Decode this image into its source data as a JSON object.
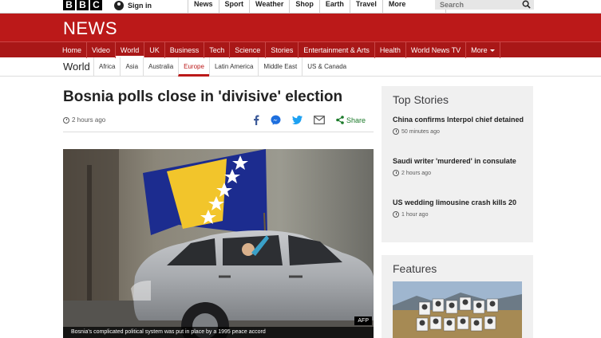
{
  "topbar": {
    "logo_letters": [
      "B",
      "B",
      "C"
    ],
    "signin": "Sign in",
    "links": [
      "News",
      "Sport",
      "Weather",
      "Shop",
      "Earth",
      "Travel",
      "More"
    ],
    "search_placeholder": "Search"
  },
  "masthead": {
    "title": "NEWS",
    "nav": [
      "Home",
      "Video",
      "World",
      "UK",
      "Business",
      "Tech",
      "Science",
      "Stories",
      "Entertainment & Arts",
      "Health",
      "World News TV",
      "More"
    ],
    "active": "World"
  },
  "subnav": {
    "title": "World",
    "links": [
      "Africa",
      "Asia",
      "Australia",
      "Europe",
      "Latin America",
      "Middle East",
      "US & Canada"
    ],
    "active": "Europe"
  },
  "article": {
    "headline": "Bosnia polls close in 'divisive' election",
    "timestamp": "2 hours ago",
    "share_label": "Share",
    "image_caption": "Bosnia's complicated political system was put in place by a 1995 peace accord",
    "image_credit": "AFP"
  },
  "top_stories": {
    "title": "Top Stories",
    "items": [
      {
        "headline": "China confirms Interpol chief detained",
        "time": "50 minutes ago"
      },
      {
        "headline": "Saudi writer 'murdered' in consulate",
        "time": "2 hours ago"
      },
      {
        "headline": "US wedding limousine crash kills 20",
        "time": "1 hour ago"
      }
    ]
  },
  "features": {
    "title": "Features"
  },
  "colors": {
    "brand_red": "#bb1919",
    "nav_red": "#a91717",
    "share_green": "#1b7a2a"
  }
}
